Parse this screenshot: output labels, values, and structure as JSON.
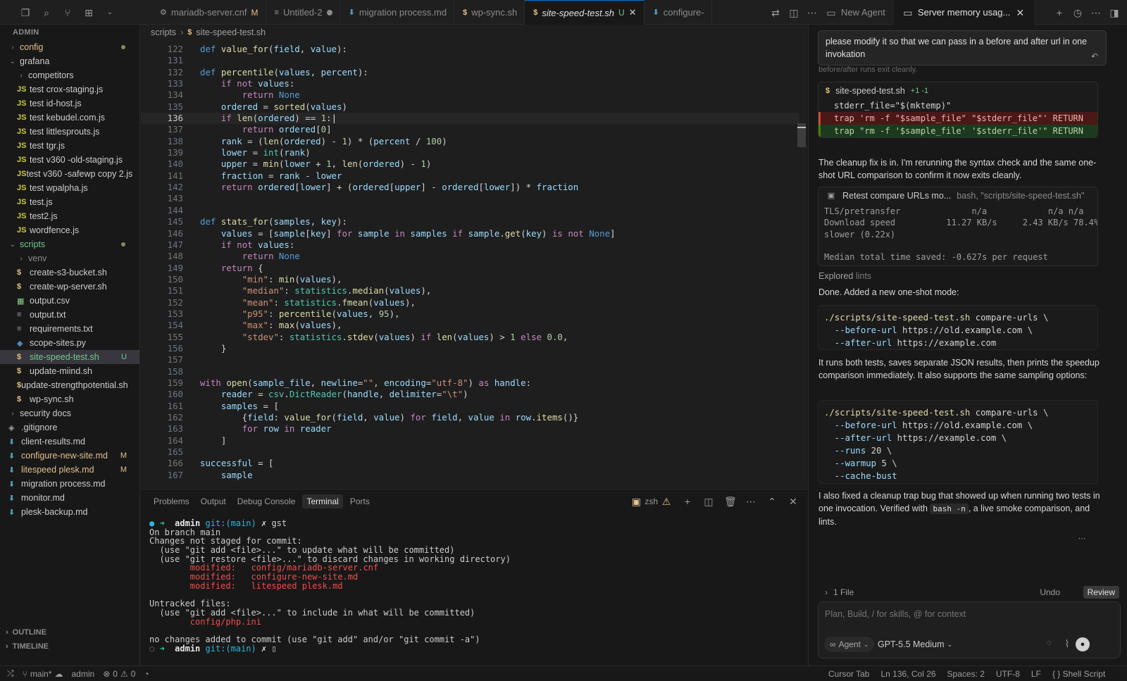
{
  "tabs": [
    {
      "label": "mariadb-server.cnf",
      "marker": "M",
      "type": "cnf"
    },
    {
      "label": "Untitled-2",
      "marker": "dot",
      "type": "txt"
    },
    {
      "label": "migration process.md",
      "marker": "",
      "type": "md"
    },
    {
      "label": "wp-sync.sh",
      "marker": "",
      "type": "sh"
    },
    {
      "label": "site-speed-test.sh",
      "marker": "U",
      "type": "sh",
      "active": true
    },
    {
      "label": "configure-",
      "marker": "",
      "type": "md"
    }
  ],
  "chat_tabs": {
    "new_agent": "New Agent",
    "current": "Server memory usag..."
  },
  "sidebar": {
    "root": "ADMIN",
    "items": [
      {
        "label": "config",
        "kind": "folder",
        "depth": 0,
        "open": false,
        "status": "mod-dot"
      },
      {
        "label": "grafana",
        "kind": "folder",
        "depth": 0,
        "open": true
      },
      {
        "label": "competitors",
        "kind": "folder",
        "depth": 1,
        "open": false
      },
      {
        "label": "test crox-staging.js",
        "kind": "js",
        "depth": 1
      },
      {
        "label": "test id-host.js",
        "kind": "js",
        "depth": 1
      },
      {
        "label": "test kebudel.com.js",
        "kind": "js",
        "depth": 1
      },
      {
        "label": "test littlesprouts.js",
        "kind": "js",
        "depth": 1
      },
      {
        "label": "test tgr.js",
        "kind": "js",
        "depth": 1
      },
      {
        "label": "test v360 -old-staging.js",
        "kind": "js",
        "depth": 1
      },
      {
        "label": "test v360 -safewp copy 2.js",
        "kind": "js",
        "depth": 1
      },
      {
        "label": "test wpalpha.js",
        "kind": "js",
        "depth": 1
      },
      {
        "label": "test.js",
        "kind": "js",
        "depth": 1
      },
      {
        "label": "test2.js",
        "kind": "js",
        "depth": 1
      },
      {
        "label": "wordfence.js",
        "kind": "js",
        "depth": 1
      },
      {
        "label": "scripts",
        "kind": "folder",
        "depth": 0,
        "open": true,
        "status": "untr-dot"
      },
      {
        "label": "venv",
        "kind": "folder",
        "depth": 1,
        "open": false,
        "status": "ignored"
      },
      {
        "label": "create-s3-bucket.sh",
        "kind": "sh",
        "depth": 1
      },
      {
        "label": "create-wp-server.sh",
        "kind": "sh",
        "depth": 1
      },
      {
        "label": "output.csv",
        "kind": "csv",
        "depth": 1
      },
      {
        "label": "output.txt",
        "kind": "txt",
        "depth": 1
      },
      {
        "label": "requirements.txt",
        "kind": "txt",
        "depth": 1
      },
      {
        "label": "scope-sites.py",
        "kind": "py",
        "depth": 1
      },
      {
        "label": "site-speed-test.sh",
        "kind": "sh",
        "depth": 1,
        "status": "U",
        "selected": true
      },
      {
        "label": "update-miind.sh",
        "kind": "sh",
        "depth": 1
      },
      {
        "label": "update-strengthpotential.sh",
        "kind": "sh",
        "depth": 1
      },
      {
        "label": "wp-sync.sh",
        "kind": "sh",
        "depth": 1
      },
      {
        "label": "security docs",
        "kind": "folder",
        "depth": 0,
        "open": false
      },
      {
        "label": ".gitignore",
        "kind": "git",
        "depth": 0
      },
      {
        "label": "client-results.md",
        "kind": "md",
        "depth": 0
      },
      {
        "label": "configure-new-site.md",
        "kind": "md",
        "depth": 0,
        "status": "M"
      },
      {
        "label": "litespeed plesk.md",
        "kind": "md",
        "depth": 0,
        "status": "M"
      },
      {
        "label": "migration process.md",
        "kind": "md",
        "depth": 0
      },
      {
        "label": "monitor.md",
        "kind": "md",
        "depth": 0
      },
      {
        "label": "plesk-backup.md",
        "kind": "md",
        "depth": 0
      }
    ],
    "outline": "OUTLINE",
    "timeline": "TIMELINE"
  },
  "breadcrumb": {
    "folder": "scripts",
    "file": "site-speed-test.sh"
  },
  "code": {
    "current_line": 136,
    "lines": [
      {
        "n": 122,
        "h": "<span class='nn'>def</span> <span class='fn'>value_for</span>(<span class='pm'>field</span>, <span class='pm'>value</span>):"
      },
      {
        "n": 131,
        "h": ""
      },
      {
        "n": 132,
        "h": "<span class='nn'>def</span> <span class='fn'>percentile</span>(<span class='pm'>values</span>, <span class='pm'>percent</span>):"
      },
      {
        "n": 133,
        "h": "    <span class='kw'>if</span> <span class='kw'>not</span> <span class='pm'>values</span>:"
      },
      {
        "n": 134,
        "h": "        <span class='kw'>return</span> <span class='nn'>None</span>"
      },
      {
        "n": 135,
        "h": "    <span class='pm'>ordered</span> = <span class='fn'>sorted</span>(<span class='pm'>values</span>)"
      },
      {
        "n": 136,
        "h": "    <span class='kw'>if</span> <span class='fn'>len</span>(<span class='pm'>ordered</span>) == <span class='nm'>1</span>:"
      },
      {
        "n": 137,
        "h": "        <span class='kw'>return</span> <span class='pm'>ordered</span>[<span class='nm'>0</span>]"
      },
      {
        "n": 138,
        "h": "    <span class='pm'>rank</span> = (<span class='fn'>len</span>(<span class='pm'>ordered</span>) - <span class='nm'>1</span>) * (<span class='pm'>percent</span> / <span class='nm'>100</span>)"
      },
      {
        "n": 139,
        "h": "    <span class='pm'>lower</span> = <span class='bi'>int</span>(<span class='pm'>rank</span>)"
      },
      {
        "n": 140,
        "h": "    <span class='pm'>upper</span> = <span class='fn'>min</span>(<span class='pm'>lower</span> + <span class='nm'>1</span>, <span class='fn'>len</span>(<span class='pm'>ordered</span>) - <span class='nm'>1</span>)"
      },
      {
        "n": 141,
        "h": "    <span class='pm'>fraction</span> = <span class='pm'>rank</span> - <span class='pm'>lower</span>"
      },
      {
        "n": 142,
        "h": "    <span class='kw'>return</span> <span class='pm'>ordered</span>[<span class='pm'>lower</span>] + (<span class='pm'>ordered</span>[<span class='pm'>upper</span>] - <span class='pm'>ordered</span>[<span class='pm'>lower</span>]) * <span class='pm'>fraction</span>"
      },
      {
        "n": 143,
        "h": ""
      },
      {
        "n": 144,
        "h": ""
      },
      {
        "n": 145,
        "h": "<span class='nn'>def</span> <span class='fn'>stats_for</span>(<span class='pm'>samples</span>, <span class='pm'>key</span>):"
      },
      {
        "n": 146,
        "h": "    <span class='pm'>values</span> = [<span class='pm'>sample</span>[<span class='pm'>key</span>] <span class='kw'>for</span> <span class='pm'>sample</span> <span class='kw'>in</span> <span class='pm'>samples</span> <span class='kw'>if</span> <span class='pm'>sample</span>.<span class='fn'>get</span>(<span class='pm'>key</span>) <span class='kw'>is not</span> <span class='nn'>None</span>]"
      },
      {
        "n": 147,
        "h": "    <span class='kw'>if</span> <span class='kw'>not</span> <span class='pm'>values</span>:"
      },
      {
        "n": 148,
        "h": "        <span class='kw'>return</span> <span class='nn'>None</span>"
      },
      {
        "n": 149,
        "h": "    <span class='kw'>return</span> {"
      },
      {
        "n": 150,
        "h": "        <span class='st'>\"min\"</span>: <span class='fn'>min</span>(<span class='pm'>values</span>),"
      },
      {
        "n": 151,
        "h": "        <span class='st'>\"median\"</span>: <span class='bi'>statistics</span>.<span class='fn'>median</span>(<span class='pm'>values</span>),"
      },
      {
        "n": 152,
        "h": "        <span class='st'>\"mean\"</span>: <span class='bi'>statistics</span>.<span class='fn'>fmean</span>(<span class='pm'>values</span>),"
      },
      {
        "n": 153,
        "h": "        <span class='st'>\"p95\"</span>: <span class='fn'>percentile</span>(<span class='pm'>values</span>, <span class='nm'>95</span>),"
      },
      {
        "n": 154,
        "h": "        <span class='st'>\"max\"</span>: <span class='fn'>max</span>(<span class='pm'>values</span>),"
      },
      {
        "n": 155,
        "h": "        <span class='st'>\"stdev\"</span>: <span class='bi'>statistics</span>.<span class='fn'>stdev</span>(<span class='pm'>values</span>) <span class='kw'>if</span> <span class='fn'>len</span>(<span class='pm'>values</span>) &gt; <span class='nm'>1</span> <span class='kw'>else</span> <span class='nm'>0.0</span>,"
      },
      {
        "n": 156,
        "h": "    }"
      },
      {
        "n": 157,
        "h": ""
      },
      {
        "n": 158,
        "h": ""
      },
      {
        "n": 159,
        "h": "<span class='kw'>with</span> <span class='fn'>open</span>(<span class='pm'>sample_file</span>, <span class='pm'>newline</span>=<span class='st'>\"\"</span>, <span class='pm'>encoding</span>=<span class='st'>\"utf-8\"</span>) <span class='kw'>as</span> <span class='pm'>handle</span>:"
      },
      {
        "n": 160,
        "h": "    <span class='pm'>reader</span> = <span class='bi'>csv</span>.<span class='bi'>DictReader</span>(<span class='pm'>handle</span>, <span class='pm'>delimiter</span>=<span class='st'>\"\\t\"</span>)"
      },
      {
        "n": 161,
        "h": "    <span class='pm'>samples</span> = ["
      },
      {
        "n": 162,
        "h": "        {<span class='pm'>field</span>: <span class='fn'>value_for</span>(<span class='pm'>field</span>, <span class='pm'>value</span>) <span class='kw'>for</span> <span class='pm'>field</span>, <span class='pm'>value</span> <span class='kw'>in</span> <span class='pm'>row</span>.<span class='fn'>items</span>()}"
      },
      {
        "n": 163,
        "h": "        <span class='kw'>for</span> <span class='pm'>row</span> <span class='kw'>in</span> <span class='pm'>reader</span>"
      },
      {
        "n": 164,
        "h": "    ]"
      },
      {
        "n": 165,
        "h": ""
      },
      {
        "n": 166,
        "h": "<span class='pm'>successful</span> = ["
      },
      {
        "n": 167,
        "h": "    <span class='pm'>sample</span>"
      }
    ]
  },
  "panel": {
    "tabs": [
      "Problems",
      "Output",
      "Debug Console",
      "Terminal",
      "Ports"
    ],
    "active": "Terminal",
    "shell": "zsh"
  },
  "terminal": {
    "prompt_user": "admin",
    "prompt_git": "git:(main)",
    "cmd": "gst",
    "lines": [
      "On branch main",
      "Changes not staged for commit:",
      "  (use \"git add <file>...\" to update what will be committed)",
      "  (use \"git restore <file>...\" to discard changes in working directory)"
    ],
    "modified": [
      "config/mariadb-server.cnf",
      "configure-new-site.md",
      "litespeed plesk.md"
    ],
    "modified_label": "modified:",
    "untracked_head": "Untracked files:",
    "untracked_hint": "  (use \"git add <file>...\" to include in what will be committed)",
    "untracked": [
      "config/php.ini"
    ],
    "tail": "no changes added to commit (use \"git add\" and/or \"git commit -a\")"
  },
  "chat": {
    "user_msg": "please modify it so that we can pass in a before and after url in one invokation",
    "faded": "before/after runs exit cleanly.",
    "diff_file": "site-speed-test.sh",
    "diff_stats": "+1 -1",
    "diff_lines": [
      {
        "t": "ctx",
        "text": "stderr_file=\"$(mktemp)\""
      },
      {
        "t": "del",
        "text": "trap 'rm -f \"$sample_file\" \"$stderr_file\"' RETURN"
      },
      {
        "t": "add",
        "text": "trap \"rm -f '$sample_file' '$stderr_file'\" RETURN"
      }
    ],
    "p1": "The cleanup fix is in. I'm rerunning the syntax check and the same one-shot URL comparison to confirm it now exits cleanly.",
    "tool_title": "Retest compare URLs mo...",
    "tool_sub": "bash, \"scripts/site-speed-test.sh\"",
    "tool_out": "TLS/pretransfer              n/a            n/a n/a\nDownload speed          11.27 KB/s     2.43 KB/s 78.4%\nslower (0.22x)\n\nMedian total time saved: -0.627s per request",
    "explored": "Explored",
    "explored_target": "lints",
    "p2": "Done. Added a new one-shot mode:",
    "code1": [
      "./scripts/site-speed-test.sh compare-urls \\",
      "  --before-url https://old.example.com \\",
      "  --after-url https://example.com"
    ],
    "p3": "It runs both tests, saves separate JSON results, then prints the speedup comparison immediately. It also supports the same sampling options:",
    "code2": [
      "./scripts/site-speed-test.sh compare-urls \\",
      "  --before-url https://old.example.com \\",
      "  --after-url https://example.com \\",
      "  --runs 20 \\",
      "  --warmup 5 \\",
      "  --cache-bust"
    ],
    "p4a": "I also fixed a cleanup trap bug that showed up when running two tests in one invocation. Verified with",
    "p4code": "bash -n",
    "p4b": ", a live smoke comparison, and lints.",
    "files_label": "1 File",
    "undo": "Undo",
    "review": "Review",
    "placeholder": "Plan, Build, / for skills, @ for context",
    "mode": "Agent",
    "model": "GPT-5.5 Medium"
  },
  "status": {
    "branch": "main*",
    "user": "admin",
    "errors": "0",
    "warnings": "0",
    "right": [
      "Cursor Tab",
      "Ln 136, Col 26",
      "Spaces: 2",
      "UTF-8",
      "LF",
      "{ } Shell Script"
    ]
  },
  "colors": {
    "accent": "#0078d4",
    "modified": "#e2c08d",
    "untracked": "#73c991",
    "diff_del": "#4b1818",
    "diff_add": "#1e3a1e"
  }
}
